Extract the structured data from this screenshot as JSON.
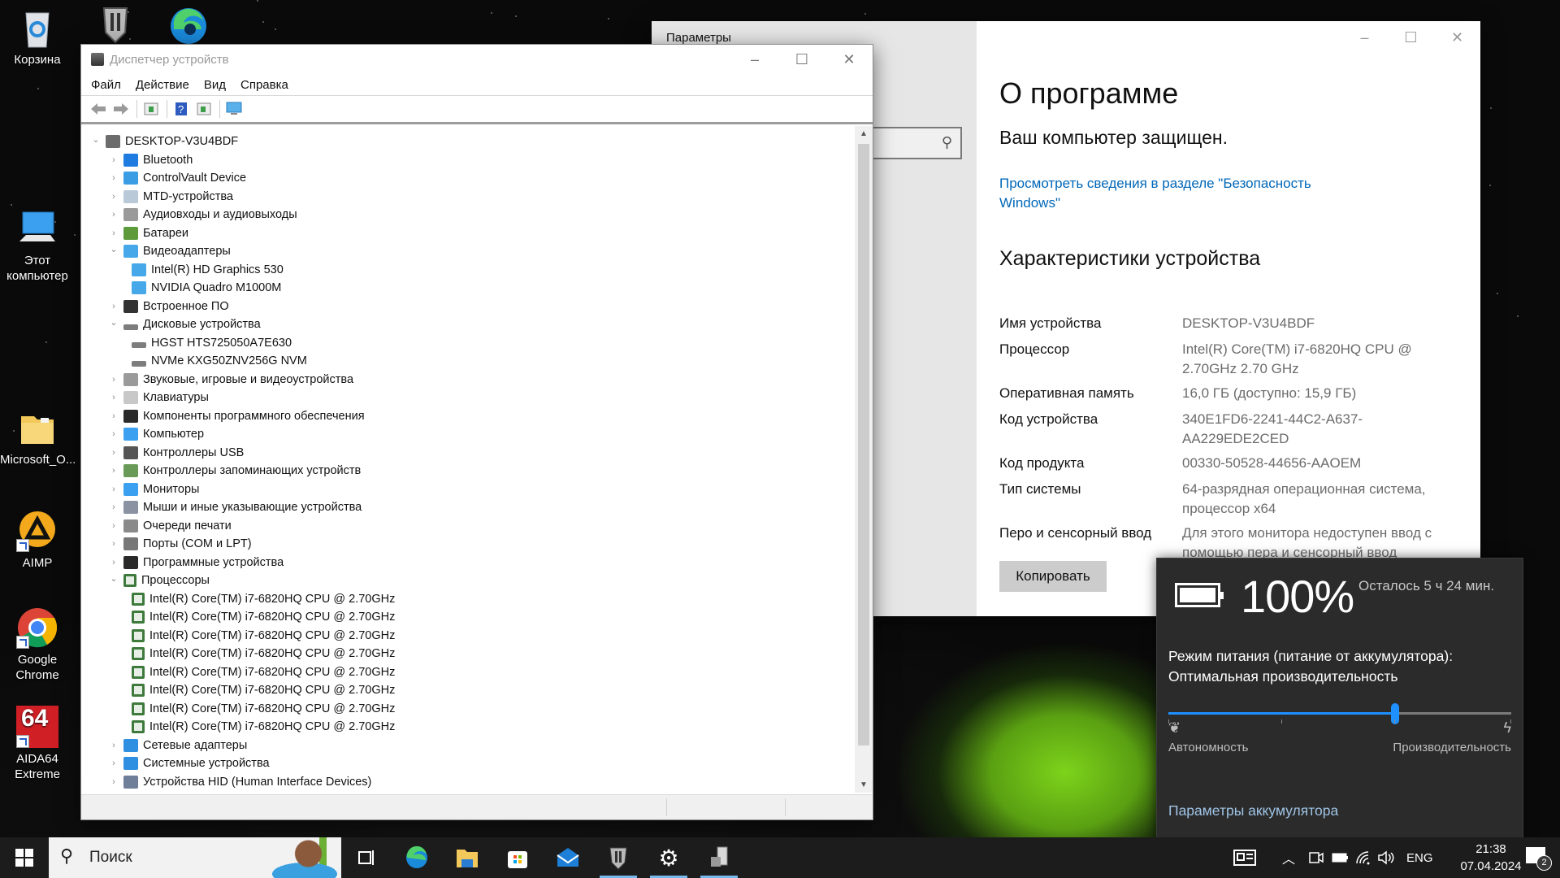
{
  "desktop": {
    "icons": [
      {
        "label": "Корзина",
        "icon": "recycle-bin-icon"
      },
      {
        "label": "Этот компьютер",
        "icon": "this-pc-icon"
      },
      {
        "label": "Microsoft_O...",
        "icon": "folder-icon"
      },
      {
        "label": "AIMP",
        "icon": "aimp-icon"
      },
      {
        "label": "Google Chrome",
        "icon": "chrome-icon"
      },
      {
        "label": "AIDA64 Extreme",
        "icon": "aida64-icon"
      }
    ],
    "top_icons": [
      "world-of-tanks-icon",
      "edge-icon"
    ]
  },
  "device_manager": {
    "title": "Диспетчер устройств",
    "menu": [
      "Файл",
      "Действие",
      "Вид",
      "Справка"
    ],
    "toolbar": [
      "back-icon",
      "forward-icon",
      "properties-pane-icon",
      "help-icon",
      "action-pane-icon",
      "monitor-scan-icon"
    ],
    "tree": [
      {
        "level": 0,
        "expanded": true,
        "label": "DESKTOP-V3U4BDF",
        "icon": "computer-root-icon"
      },
      {
        "level": 1,
        "expanded": false,
        "label": "Bluetooth",
        "icon": "bluetooth-icon"
      },
      {
        "level": 1,
        "expanded": false,
        "label": "ControlVault Device",
        "icon": "network-device-icon"
      },
      {
        "level": 1,
        "expanded": false,
        "label": "MTD-устройства",
        "icon": "mtd-icon"
      },
      {
        "level": 1,
        "expanded": false,
        "label": "Аудиовходы и аудиовыходы",
        "icon": "speaker-icon"
      },
      {
        "level": 1,
        "expanded": false,
        "label": "Батареи",
        "icon": "battery-icon"
      },
      {
        "level": 1,
        "expanded": true,
        "label": "Видеоадаптеры",
        "icon": "display-adapter-icon"
      },
      {
        "level": 2,
        "label": "Intel(R) HD Graphics 530",
        "icon": "display-adapter-icon"
      },
      {
        "level": 2,
        "label": "NVIDIA Quadro M1000M",
        "icon": "display-adapter-icon"
      },
      {
        "level": 1,
        "expanded": false,
        "label": "Встроенное ПО",
        "icon": "firmware-icon"
      },
      {
        "level": 1,
        "expanded": true,
        "label": "Дисковые устройства",
        "icon": "disk-icon"
      },
      {
        "level": 2,
        "label": "HGST HTS725050A7E630",
        "icon": "disk-icon"
      },
      {
        "level": 2,
        "label": "NVMe KXG50ZNV256G NVM",
        "icon": "disk-icon"
      },
      {
        "level": 1,
        "expanded": false,
        "label": "Звуковые, игровые и видеоустройства",
        "icon": "speaker-icon"
      },
      {
        "level": 1,
        "expanded": false,
        "label": "Клавиатуры",
        "icon": "keyboard-icon"
      },
      {
        "level": 1,
        "expanded": false,
        "label": "Компоненты программного обеспечения",
        "icon": "software-component-icon"
      },
      {
        "level": 1,
        "expanded": false,
        "label": "Компьютер",
        "icon": "computer-icon"
      },
      {
        "level": 1,
        "expanded": false,
        "label": "Контроллеры USB",
        "icon": "usb-icon"
      },
      {
        "level": 1,
        "expanded": false,
        "label": "Контроллеры запоминающих устройств",
        "icon": "storage-controller-icon"
      },
      {
        "level": 1,
        "expanded": false,
        "label": "Мониторы",
        "icon": "monitor-icon"
      },
      {
        "level": 1,
        "expanded": false,
        "label": "Мыши и иные указывающие устройства",
        "icon": "mouse-icon"
      },
      {
        "level": 1,
        "expanded": false,
        "label": "Очереди печати",
        "icon": "printer-icon"
      },
      {
        "level": 1,
        "expanded": false,
        "label": "Порты (COM и LPT)",
        "icon": "port-icon"
      },
      {
        "level": 1,
        "expanded": false,
        "label": "Программные устройства",
        "icon": "software-device-icon"
      },
      {
        "level": 1,
        "expanded": true,
        "label": "Процессоры",
        "icon": "cpu-icon"
      },
      {
        "level": 2,
        "label": "Intel(R) Core(TM) i7-6820HQ CPU @ 2.70GHz",
        "icon": "cpu-icon"
      },
      {
        "level": 2,
        "label": "Intel(R) Core(TM) i7-6820HQ CPU @ 2.70GHz",
        "icon": "cpu-icon"
      },
      {
        "level": 2,
        "label": "Intel(R) Core(TM) i7-6820HQ CPU @ 2.70GHz",
        "icon": "cpu-icon"
      },
      {
        "level": 2,
        "label": "Intel(R) Core(TM) i7-6820HQ CPU @ 2.70GHz",
        "icon": "cpu-icon"
      },
      {
        "level": 2,
        "label": "Intel(R) Core(TM) i7-6820HQ CPU @ 2.70GHz",
        "icon": "cpu-icon"
      },
      {
        "level": 2,
        "label": "Intel(R) Core(TM) i7-6820HQ CPU @ 2.70GHz",
        "icon": "cpu-icon"
      },
      {
        "level": 2,
        "label": "Intel(R) Core(TM) i7-6820HQ CPU @ 2.70GHz",
        "icon": "cpu-icon"
      },
      {
        "level": 2,
        "label": "Intel(R) Core(TM) i7-6820HQ CPU @ 2.70GHz",
        "icon": "cpu-icon"
      },
      {
        "level": 1,
        "expanded": false,
        "label": "Сетевые адаптеры",
        "icon": "network-adapter-icon"
      },
      {
        "level": 1,
        "expanded": false,
        "label": "Системные устройства",
        "icon": "system-device-icon"
      },
      {
        "level": 1,
        "expanded": false,
        "label": "Устройства HID (Human Interface Devices)",
        "icon": "hid-icon"
      }
    ]
  },
  "settings": {
    "app_title": "Параметры",
    "page_title": "О программе",
    "protection_status": "Ваш компьютер защищен.",
    "security_link": "Просмотреть сведения в разделе \"Безопасность Windows\"",
    "specs_title": "Характеристики устройства",
    "specs": [
      {
        "key": "Имя устройства",
        "value": "DESKTOP-V3U4BDF"
      },
      {
        "key": "Процессор",
        "value": "Intel(R) Core(TM) i7-6820HQ CPU @ 2.70GHz   2.70 GHz"
      },
      {
        "key": "Оперативная память",
        "value": "16,0 ГБ (доступно: 15,9 ГБ)"
      },
      {
        "key": "Код устройства",
        "value": "340E1FD6-2241-44C2-A637-AA229EDE2CED"
      },
      {
        "key": "Код продукта",
        "value": "00330-50528-44656-AAOEM"
      },
      {
        "key": "Тип системы",
        "value": "64-разрядная операционная система, процессор x64"
      },
      {
        "key": "Перо и сенсорный ввод",
        "value": "Для этого монитора недоступен ввод с помощью пера и сенсорный ввод"
      }
    ],
    "copy_button": "Копировать"
  },
  "battery_flyout": {
    "percent_label": "100%",
    "charge_fraction": 1.0,
    "remaining": "Осталось 5 ч 24 мин.",
    "mode_label": "Режим питания (питание от аккумулятора):",
    "mode_value": "Оптимальная производительность",
    "slider_position": 0.66,
    "slider_ticks": [
      0,
      0.33,
      0.66,
      1.0
    ],
    "left_label": "Автономность",
    "right_label": "Производительность",
    "settings_link": "Параметры аккумулятора",
    "accent": "#1e90ff"
  },
  "taskbar": {
    "search_placeholder": "Поиск",
    "apps": [
      {
        "name": "task-view",
        "active": false
      },
      {
        "name": "edge",
        "active": false
      },
      {
        "name": "file-explorer",
        "active": false
      },
      {
        "name": "microsoft-store",
        "active": false
      },
      {
        "name": "mail",
        "active": false
      },
      {
        "name": "world-of-tanks",
        "active": true
      },
      {
        "name": "settings",
        "active": true
      },
      {
        "name": "device-manager",
        "active": true
      }
    ],
    "language": "ENG",
    "time": "21:38",
    "date": "07.04.2024",
    "notification_count": "2"
  }
}
